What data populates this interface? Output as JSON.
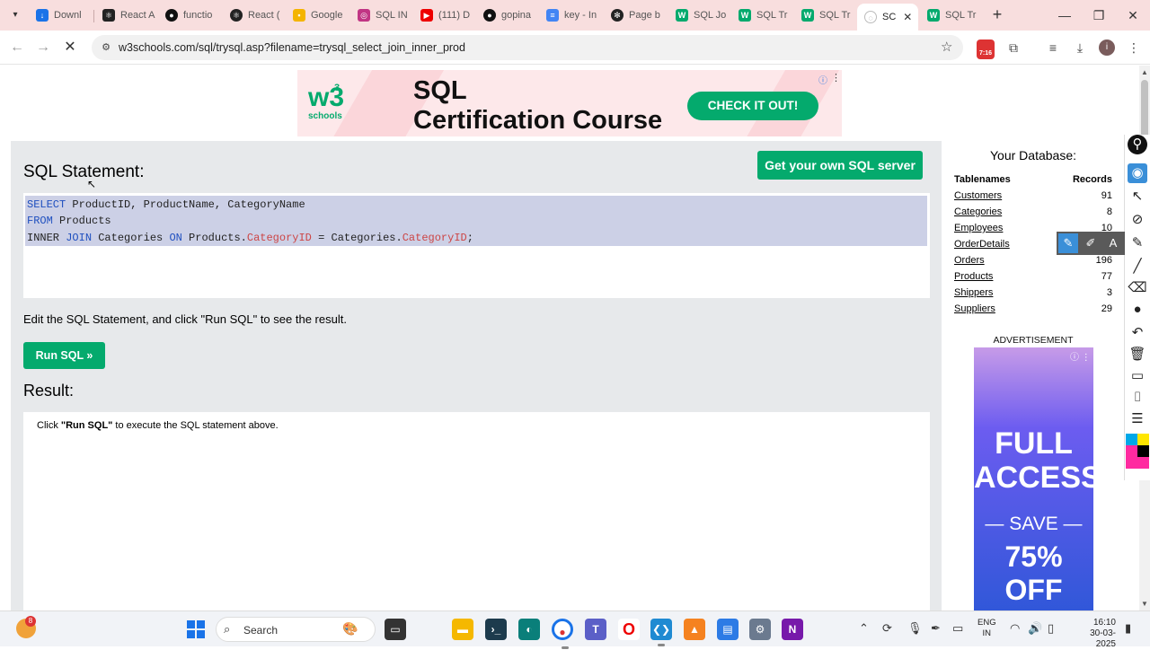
{
  "browser": {
    "tabs": [
      {
        "label": "Downl",
        "color": "#1a73e8",
        "icon": "download-icon"
      },
      {
        "label": "React A",
        "color": "#222",
        "icon": "react-icon"
      },
      {
        "label": "functio",
        "color": "#111",
        "icon": "github-icon"
      },
      {
        "label": "React (",
        "color": "#222",
        "icon": "react-icon"
      },
      {
        "label": "Google",
        "color": "#f4b400",
        "icon": "google-icon"
      },
      {
        "label": "SQL IN",
        "color": "#c13584",
        "icon": "instagram-icon"
      },
      {
        "label": "(111) D",
        "color": "#e00",
        "icon": "youtube-icon"
      },
      {
        "label": "gopina",
        "color": "#111",
        "icon": "github-icon"
      },
      {
        "label": "key - In",
        "color": "#4285f4",
        "icon": "docs-icon"
      },
      {
        "label": "Page b",
        "color": "#222",
        "icon": "openai-icon"
      },
      {
        "label": "SQL Jo",
        "color": "#04aa6d",
        "icon": "w3schools-icon"
      },
      {
        "label": "SQL Tr",
        "color": "#04aa6d",
        "icon": "w3schools-icon"
      },
      {
        "label": "SQL Tr",
        "color": "#04aa6d",
        "icon": "w3schools-icon"
      },
      {
        "label": "SC",
        "color": "#888",
        "icon": "loading-icon",
        "active": true
      },
      {
        "label": "SQL Tr",
        "color": "#04aa6d",
        "icon": "w3schools-icon"
      }
    ],
    "url": "w3schools.com/sql/trysql.asp?filename=trysql_select_join_inner_prod",
    "extension_time": "7:16",
    "profile_initial": "i"
  },
  "ad_top": {
    "brand": "w3",
    "brand_sup": "3",
    "brand_name": "schools",
    "title_line1": "SQL",
    "title_line2": "Certification Course",
    "cta": "CHECK IT OUT!"
  },
  "main": {
    "sql_heading": "SQL Statement:",
    "own_server_label": "Get your own SQL server",
    "code": {
      "line1": {
        "kw": "SELECT",
        "rest": " ProductID, ProductName, CategoryName"
      },
      "line2": {
        "kw": "FROM",
        "rest": " Products"
      },
      "line3": {
        "p1": "INNER ",
        "kw1": "JOIN",
        "p2": " Categories ",
        "kw2": "ON",
        "p3": " Products.",
        "f1": "CategoryID",
        "p4": " = Categories.",
        "f2": "CategoryID",
        "p5": ";"
      }
    },
    "edit_hint": "Edit the SQL Statement, and click \"Run SQL\" to see the result.",
    "run_label": "Run SQL »",
    "result_heading": "Result:",
    "result_msg_pre": "Click ",
    "result_msg_bold": "\"Run SQL\"",
    "result_msg_post": " to execute the SQL statement above."
  },
  "database": {
    "title": "Your Database:",
    "col_table": "Tablenames",
    "col_records": "Records",
    "tables": [
      {
        "name": "Customers",
        "records": "91"
      },
      {
        "name": "Categories",
        "records": "8"
      },
      {
        "name": "Employees",
        "records": "10"
      },
      {
        "name": "OrderDetails",
        "records": ""
      },
      {
        "name": "Orders",
        "records": "196"
      },
      {
        "name": "Products",
        "records": "77"
      },
      {
        "name": "Shippers",
        "records": "3"
      },
      {
        "name": "Suppliers",
        "records": "29"
      }
    ]
  },
  "side_ad": {
    "label": "ADVERTISEMENT",
    "line1": "FULL",
    "line2": "ACCESS",
    "save": "— SAVE —",
    "off": "75% OFF"
  },
  "taskbar": {
    "weather_badge": "8",
    "search_placeholder": "Search",
    "lang_line1": "ENG",
    "lang_line2": "IN",
    "time": "16:10",
    "date": "30-03-2025"
  }
}
